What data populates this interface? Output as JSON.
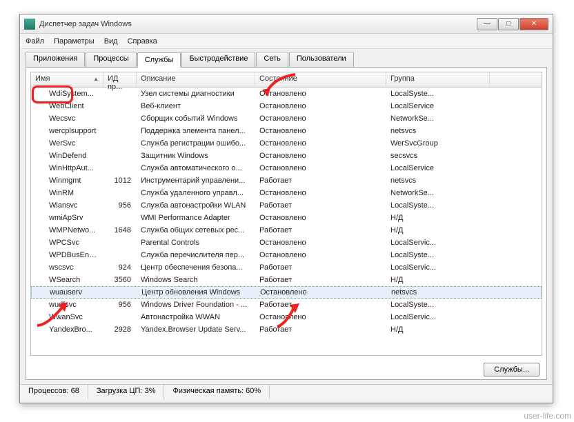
{
  "window": {
    "title": "Диспетчер задач Windows"
  },
  "menu": [
    "Файл",
    "Параметры",
    "Вид",
    "Справка"
  ],
  "tabs": [
    "Приложения",
    "Процессы",
    "Службы",
    "Быстродействие",
    "Сеть",
    "Пользователи"
  ],
  "active_tab": 2,
  "columns": [
    "Имя",
    "ИД пр...",
    "Описание",
    "Состояние",
    "Группа"
  ],
  "services_button": "Службы...",
  "status": {
    "processes": "Процессов: 68",
    "cpu": "Загрузка ЦП: 3%",
    "mem": "Физическая память: 60%"
  },
  "watermark": "user-life.com",
  "selected_row": 17,
  "rows": [
    {
      "name": "WdiSystem...",
      "pid": "",
      "desc": "Узел системы диагностики",
      "state": "Остановлено",
      "group": "LocalSyste..."
    },
    {
      "name": "WebClient",
      "pid": "",
      "desc": "Веб-клиент",
      "state": "Остановлено",
      "group": "LocalService"
    },
    {
      "name": "Wecsvc",
      "pid": "",
      "desc": "Сборщик событий Windows",
      "state": "Остановлено",
      "group": "NetworkSe..."
    },
    {
      "name": "wercplsupport",
      "pid": "",
      "desc": "Поддержка элемента панел...",
      "state": "Остановлено",
      "group": "netsvcs"
    },
    {
      "name": "WerSvc",
      "pid": "",
      "desc": "Служба регистрации ошибо...",
      "state": "Остановлено",
      "group": "WerSvcGroup"
    },
    {
      "name": "WinDefend",
      "pid": "",
      "desc": "Защитник Windows",
      "state": "Остановлено",
      "group": "secsvcs"
    },
    {
      "name": "WinHttpAut...",
      "pid": "",
      "desc": "Служба автоматического о...",
      "state": "Остановлено",
      "group": "LocalService"
    },
    {
      "name": "Winmgmt",
      "pid": "1012",
      "desc": "Инструментарий управлени...",
      "state": "Работает",
      "group": "netsvcs"
    },
    {
      "name": "WinRM",
      "pid": "",
      "desc": "Служба удаленного управл...",
      "state": "Остановлено",
      "group": "NetworkSe..."
    },
    {
      "name": "Wlansvc",
      "pid": "956",
      "desc": "Служба автонастройки WLAN",
      "state": "Работает",
      "group": "LocalSyste..."
    },
    {
      "name": "wmiApSrv",
      "pid": "",
      "desc": "WMI Performance Adapter",
      "state": "Остановлено",
      "group": "Н/Д"
    },
    {
      "name": "WMPNetwo...",
      "pid": "1648",
      "desc": "Служба общих сетевых рес...",
      "state": "Работает",
      "group": "Н/Д"
    },
    {
      "name": "WPCSvc",
      "pid": "",
      "desc": "Parental Controls",
      "state": "Остановлено",
      "group": "LocalServic..."
    },
    {
      "name": "WPDBusEnum",
      "pid": "",
      "desc": "Служба перечислителя пер...",
      "state": "Остановлено",
      "group": "LocalSyste..."
    },
    {
      "name": "wscsvc",
      "pid": "924",
      "desc": "Центр обеспечения безопа...",
      "state": "Работает",
      "group": "LocalServic..."
    },
    {
      "name": "WSearch",
      "pid": "3560",
      "desc": "Windows Search",
      "state": "Работает",
      "group": "Н/Д"
    },
    {
      "name": "wuauserv",
      "pid": "",
      "desc": "Центр обновления Windows",
      "state": "Остановлено",
      "group": "netsvcs"
    },
    {
      "name": "wudfsvc",
      "pid": "956",
      "desc": "Windows Driver Foundation - ...",
      "state": "Работает",
      "group": "LocalSyste..."
    },
    {
      "name": "WwanSvc",
      "pid": "",
      "desc": "Автонастройка WWAN",
      "state": "Остановлено",
      "group": "LocalServic..."
    },
    {
      "name": "YandexBro...",
      "pid": "2928",
      "desc": "Yandex.Browser Update Serv...",
      "state": "Работает",
      "group": "Н/Д"
    }
  ]
}
